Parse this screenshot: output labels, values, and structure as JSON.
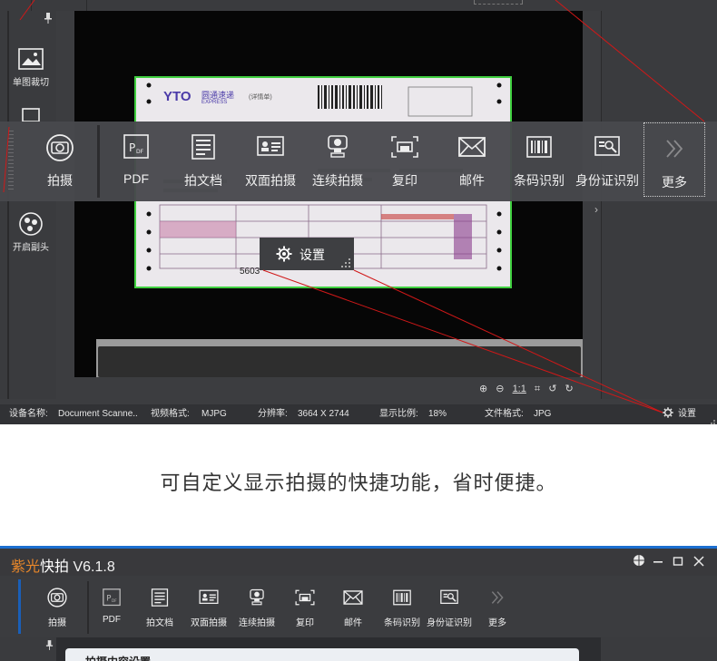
{
  "top_screenshot": {
    "sidebar": {
      "tools": [
        {
          "label": "单图裁切",
          "icon": "image-crop-icon"
        },
        {
          "label": "开启副头",
          "icon": "secondary-camera-icon"
        }
      ]
    },
    "floating_toolbar": {
      "items": [
        {
          "label": "拍摄",
          "icon": "camera-icon"
        },
        {
          "label": "PDF",
          "icon": "pdf-icon"
        },
        {
          "label": "拍文档",
          "icon": "document-icon"
        },
        {
          "label": "双面拍摄",
          "icon": "id-card-icon"
        },
        {
          "label": "连续拍摄",
          "icon": "continuous-shoot-icon"
        },
        {
          "label": "复印",
          "icon": "copy-printer-icon"
        },
        {
          "label": "邮件",
          "icon": "mail-icon"
        },
        {
          "label": "条码识别",
          "icon": "barcode-icon"
        },
        {
          "label": "身份证识别",
          "icon": "id-recognition-icon"
        },
        {
          "label": "更多",
          "icon": "double-chevron-right-icon"
        }
      ]
    },
    "settings_popup": {
      "label": "设置"
    },
    "document_preview": {
      "courier_logo": "YTO",
      "company": "圆通速递",
      "sub": "EXPRESS",
      "form_title": "(详情单)",
      "number_snippet": "5603"
    },
    "zoom_controls": [
      "zoom-in-icon",
      "zoom-out-icon",
      "1:1",
      "fit-icon",
      "rotate-left-icon",
      "rotate-right-icon"
    ],
    "status_bar": {
      "device_label": "设备名称:",
      "device_value": "Document Scanne..",
      "video_label": "视频格式:",
      "video_value": "MJPG",
      "resolution_label": "分辨率:",
      "resolution_value": "3664 X 2744",
      "ratio_label": "显示比例:",
      "ratio_value": "18%",
      "file_label": "文件格式:",
      "file_value": "JPG",
      "settings_label": "设置"
    }
  },
  "caption": "可自定义显示拍摄的快捷功能，省时便捷。",
  "bottom_screenshot": {
    "title_brand": "紫光",
    "title_app": "快拍",
    "title_version": "V6.1.8",
    "window_controls": [
      "globe-icon",
      "minimize-icon",
      "maximize-icon",
      "close-icon"
    ],
    "toolbar": {
      "items": [
        {
          "label": "拍摄",
          "icon": "camera-icon"
        },
        {
          "label": "PDF",
          "icon": "pdf-icon"
        },
        {
          "label": "拍文档",
          "icon": "document-icon"
        },
        {
          "label": "双面拍摄",
          "icon": "id-card-icon"
        },
        {
          "label": "连续拍摄",
          "icon": "continuous-shoot-icon"
        },
        {
          "label": "复印",
          "icon": "copy-printer-icon"
        },
        {
          "label": "邮件",
          "icon": "mail-icon"
        },
        {
          "label": "条码识别",
          "icon": "barcode-icon"
        },
        {
          "label": "身份证识别",
          "icon": "id-recognition-icon"
        },
        {
          "label": "更多",
          "icon": "double-chevron-right-icon"
        }
      ]
    },
    "panel_title": "拍摄内容设置"
  },
  "colors": {
    "brand_orange": "#e8872a",
    "accent_blue": "#1c6fd0",
    "annotation_red": "#d01818",
    "detect_green": "#3fcf3f"
  }
}
